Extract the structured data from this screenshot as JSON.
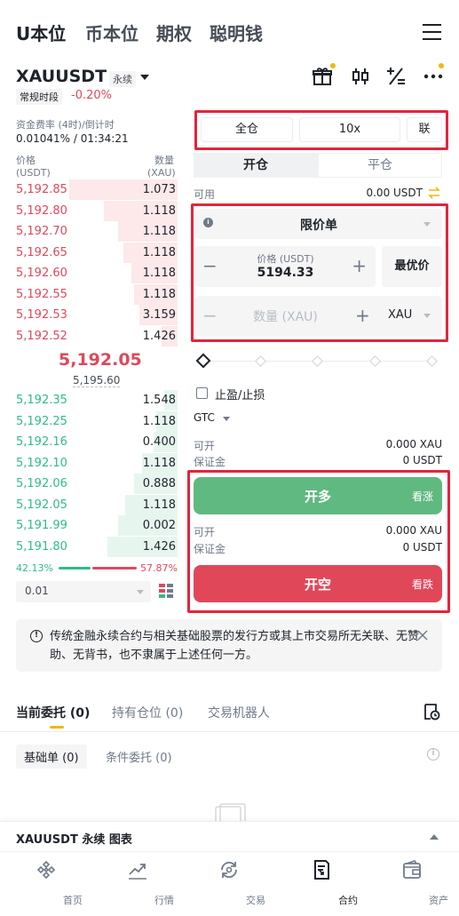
{
  "top_tabs": [
    "U本位",
    "币本位",
    "期权",
    "聪明钱"
  ],
  "symbol": {
    "name": "XAUUSDT",
    "type_tag": "永续",
    "session_tag": "常规时段",
    "change_pct": "-0.20%"
  },
  "funding": {
    "label": "资金费率 (4时)/倒计时",
    "value": "0.01041% / 01:34:21"
  },
  "orderbook": {
    "price_header": "价格",
    "price_unit": "(USDT)",
    "qty_header": "数量",
    "qty_unit": "(XAU)",
    "asks": [
      {
        "price": "5,192.85",
        "qty": "1.073",
        "depth": 1.0
      },
      {
        "price": "5,192.80",
        "qty": "1.118",
        "depth": 0.68
      },
      {
        "price": "5,192.70",
        "qty": "1.118",
        "depth": 0.55
      },
      {
        "price": "5,192.65",
        "qty": "1.118",
        "depth": 0.5
      },
      {
        "price": "5,192.60",
        "qty": "1.118",
        "depth": 0.43
      },
      {
        "price": "5,192.55",
        "qty": "1.118",
        "depth": 0.4
      },
      {
        "price": "5,192.53",
        "qty": "3.159",
        "depth": 0.35
      },
      {
        "price": "5,192.52",
        "qty": "1.426",
        "depth": 0.15
      }
    ],
    "last_price": "5,192.05",
    "mark_price": "5,195.60",
    "bids": [
      {
        "price": "5,192.35",
        "qty": "1.548",
        "depth": 0.12
      },
      {
        "price": "5,192.25",
        "qty": "1.118",
        "depth": 0.2
      },
      {
        "price": "5,192.16",
        "qty": "0.400",
        "depth": 0.22
      },
      {
        "price": "5,192.10",
        "qty": "1.118",
        "depth": 0.33
      },
      {
        "price": "5,192.06",
        "qty": "0.888",
        "depth": 0.4
      },
      {
        "price": "5,192.05",
        "qty": "1.118",
        "depth": 0.48
      },
      {
        "price": "5,191.99",
        "qty": "0.002",
        "depth": 0.55
      },
      {
        "price": "5,191.80",
        "qty": "1.426",
        "depth": 0.65
      }
    ],
    "buy_ratio": "42.13%",
    "sell_ratio": "57.87%",
    "buy_ratio_value": 42.13,
    "depth_precision": "0.01"
  },
  "trade_panel": {
    "margin_mode": "全仓",
    "leverage": "10x",
    "position_mode": "联",
    "tab_open": "开仓",
    "tab_close": "平仓",
    "available_label": "可用",
    "available_value": "0.00 USDT",
    "order_type": "限价单",
    "price_label": "价格 (USDT)",
    "price_value": "5194.33",
    "best_price_label": "最优价",
    "qty_placeholder": "数量 (XAU)",
    "qty_unit": "XAU",
    "tpsl_label": "止盈/止损",
    "tif": "GTC",
    "long_open_label": "可开",
    "long_open_value": "0.000 XAU",
    "long_margin_label": "保证金",
    "long_margin_value": "0 USDT",
    "long_button": "开多",
    "long_button_sub": "看涨",
    "short_open_label": "可开",
    "short_open_value": "0.000 XAU",
    "short_margin_label": "保证金",
    "short_margin_value": "0 USDT",
    "short_button": "开空",
    "short_button_sub": "看跌"
  },
  "notice": {
    "text": "传统金融永续合约与相关基础股票的发行方或其上市交易所无关联、无赞助、无背书，也不隶属于上述任何一方。"
  },
  "order_tabs": [
    "当前委托 (0)",
    "持有仓位 (0)",
    "交易机器人"
  ],
  "order_sub_tabs": [
    "基础单 (0)",
    "条件委托 (0)"
  ],
  "chart_strip": {
    "title": "XAUUSDT 永续 图表"
  },
  "bottom_nav": [
    {
      "label": "首页",
      "icon": "home-icon"
    },
    {
      "label": "行情",
      "icon": "markets-icon"
    },
    {
      "label": "交易",
      "icon": "trade-icon"
    },
    {
      "label": "合约",
      "icon": "futures-icon"
    },
    {
      "label": "资产",
      "icon": "wallet-icon"
    }
  ],
  "colors": {
    "ask": "#e0485a",
    "bid": "#2ebd85",
    "long_button": "#60b980",
    "short_button": "#e0485a",
    "accent": "#f0b90b",
    "highlight_box": "#e3243b"
  }
}
